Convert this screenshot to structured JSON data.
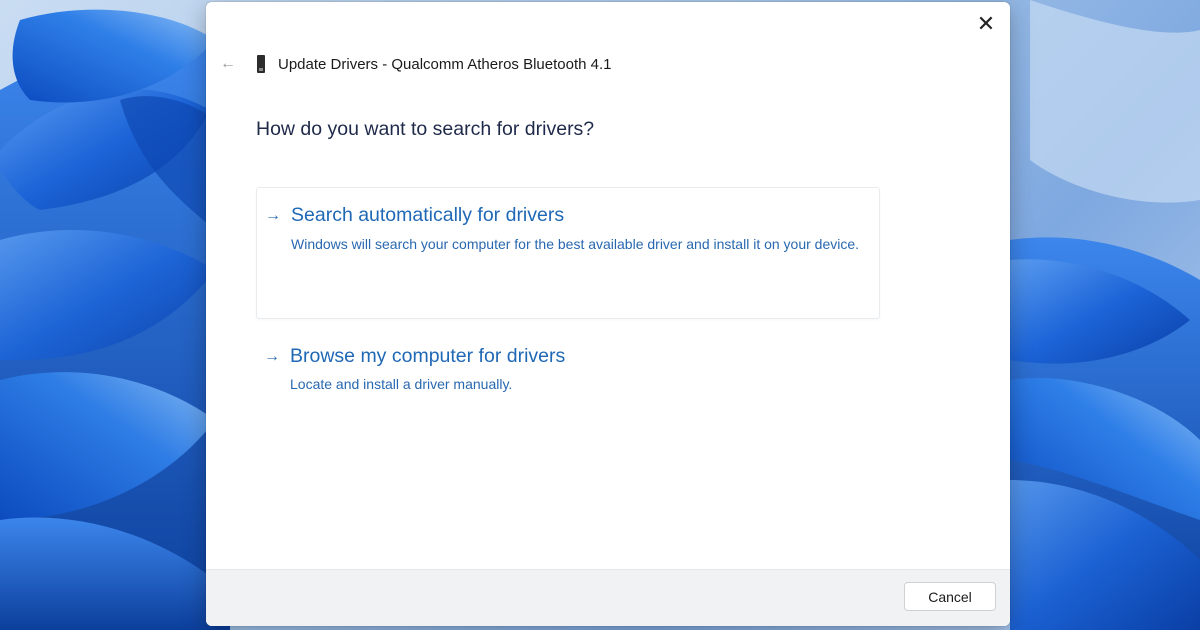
{
  "dialog": {
    "title": "Update Drivers - Qualcomm Atheros Bluetooth 4.1",
    "close_glyph": "✕",
    "back_glyph": "←",
    "heading": "How do you want to search for drivers?"
  },
  "options": [
    {
      "arrow": "→",
      "title": "Search automatically for drivers",
      "description": "Windows will search your computer for the best available driver and install it on your device."
    },
    {
      "arrow": "→",
      "title": "Browse my computer for drivers",
      "description": "Locate and install a driver manually."
    }
  ],
  "footer": {
    "cancel_label": "Cancel"
  },
  "icons": {
    "close": "close-icon",
    "back": "back-arrow-icon",
    "device": "bluetooth-device-icon",
    "option_arrow": "arrow-right-icon"
  },
  "colors": {
    "link": "#1f68b5",
    "heading": "#1f2a4a",
    "footer_bg": "#f1f2f4",
    "wallpaper_accent": "#1a5fd0"
  }
}
